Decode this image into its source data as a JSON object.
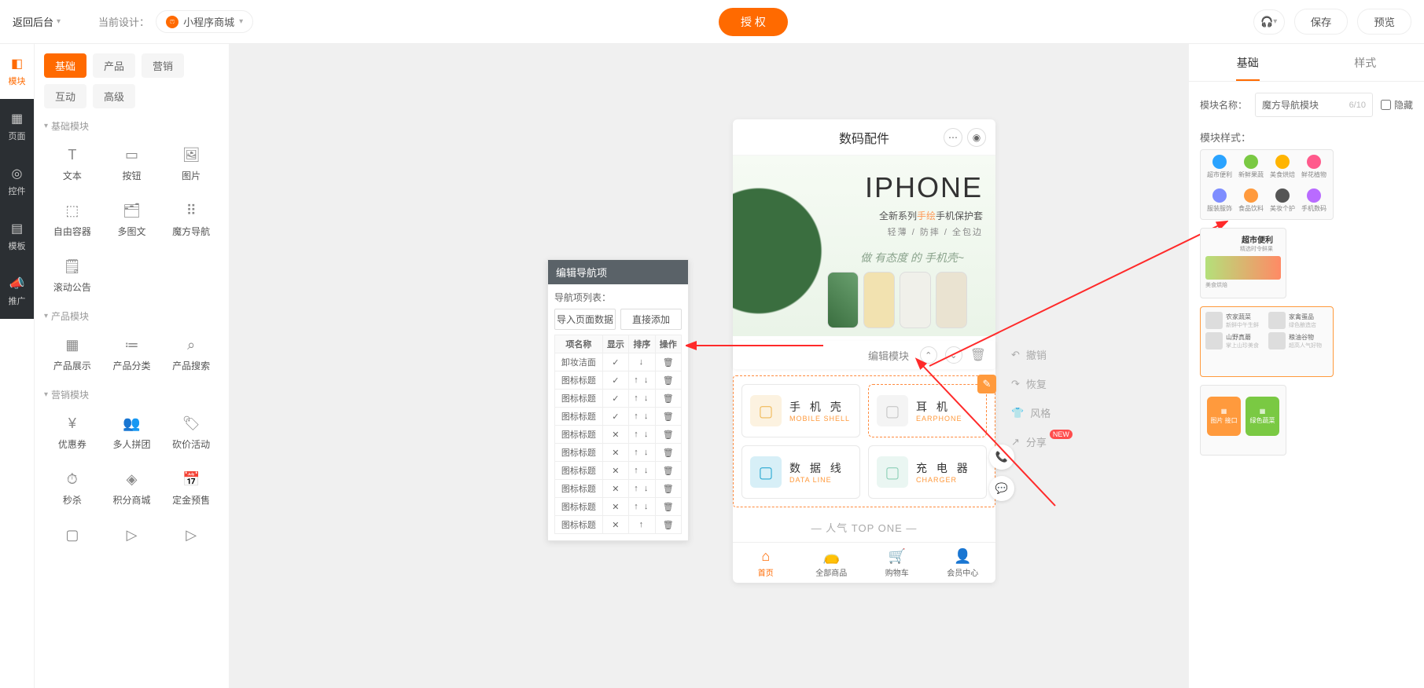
{
  "header": {
    "back": "返回后台",
    "current_design_label": "当前设计：",
    "current_design_value": "小程序商城",
    "auth_button": "授 权",
    "save": "保存",
    "preview": "预览"
  },
  "rail": [
    {
      "key": "module",
      "label": "模块",
      "active": true,
      "glyph": "◧"
    },
    {
      "key": "page",
      "label": "页面",
      "dark": true,
      "glyph": "▦"
    },
    {
      "key": "control",
      "label": "控件",
      "dark": true,
      "glyph": "◎"
    },
    {
      "key": "template",
      "label": "模板",
      "dark": true,
      "glyph": "▤"
    },
    {
      "key": "promote",
      "label": "推广",
      "dark": true,
      "glyph": "📣"
    }
  ],
  "sidebar": {
    "top_tabs": [
      {
        "label": "基础",
        "active": true
      },
      {
        "label": "产品"
      },
      {
        "label": "营销"
      },
      {
        "label": "互动"
      },
      {
        "label": "高级"
      }
    ],
    "sections": [
      {
        "title": "基础模块",
        "items": [
          {
            "label": "文本",
            "glyph": "T"
          },
          {
            "label": "按钮",
            "glyph": "▭"
          },
          {
            "label": "图片",
            "glyph": "🖼"
          },
          {
            "label": "自由容器",
            "glyph": "⬚"
          },
          {
            "label": "多图文",
            "glyph": "🗂"
          },
          {
            "label": "魔方导航",
            "glyph": "⠿"
          },
          {
            "label": "滚动公告",
            "glyph": "🗒"
          }
        ]
      },
      {
        "title": "产品模块",
        "items": [
          {
            "label": "产品展示",
            "glyph": "▦"
          },
          {
            "label": "产品分类",
            "glyph": "≔"
          },
          {
            "label": "产品搜索",
            "glyph": "⌕"
          }
        ]
      },
      {
        "title": "营销模块",
        "items": [
          {
            "label": "优惠券",
            "glyph": "¥"
          },
          {
            "label": "多人拼团",
            "glyph": "👥"
          },
          {
            "label": "砍价活动",
            "glyph": "🏷"
          },
          {
            "label": "秒杀",
            "glyph": "⏱"
          },
          {
            "label": "积分商城",
            "glyph": "◈"
          },
          {
            "label": "定金预售",
            "glyph": "📅"
          },
          {
            "label": "",
            "glyph": "▢"
          },
          {
            "label": "",
            "glyph": "▷"
          },
          {
            "label": "",
            "glyph": "▷"
          }
        ]
      }
    ]
  },
  "popover": {
    "title": "编辑导航项",
    "list_label": "导航项列表：",
    "import_btn": "导入页面数据",
    "add_btn": "直接添加",
    "th_name": "项名称",
    "th_show": "显示",
    "th_sort": "排序",
    "th_action": "操作",
    "rows": [
      {
        "name": "卸妆洁面",
        "show": true,
        "sort": "↓"
      },
      {
        "name": "图标标题",
        "show": true,
        "sort": "↑ ↓"
      },
      {
        "name": "图标标题",
        "show": true,
        "sort": "↑ ↓"
      },
      {
        "name": "图标标题",
        "show": true,
        "sort": "↑ ↓"
      },
      {
        "name": "图标标题",
        "show": false,
        "sort": "↑ ↓"
      },
      {
        "name": "图标标题",
        "show": false,
        "sort": "↑ ↓"
      },
      {
        "name": "图标标题",
        "show": false,
        "sort": "↑ ↓"
      },
      {
        "name": "图标标题",
        "show": false,
        "sort": "↑ ↓"
      },
      {
        "name": "图标标题",
        "show": false,
        "sort": "↑ ↓"
      },
      {
        "name": "图标标题",
        "show": false,
        "sort": "↑"
      }
    ]
  },
  "phone": {
    "title": "数码配件",
    "banner_h1": "IPHONE",
    "banner_sub_pre": "全新系列",
    "banner_sub_accent": "手绘",
    "banner_sub_post": "手机保护套",
    "banner_sub2": "轻薄 / 防摔 / 全包边",
    "banner_cursive": "做 有态度 的 手机壳~",
    "edit_label": "编辑模块",
    "nav_cards": [
      {
        "zh": "手 机 壳",
        "en": "MOBILE SHELL",
        "color": "#f0ba5a"
      },
      {
        "zh": "耳  机",
        "en": "EARPHONE",
        "color": "#c7c7c7",
        "selected": true
      },
      {
        "zh": "数 据 线",
        "en": "DATA LINE",
        "color": "#2aa9d2"
      },
      {
        "zh": "充 电 器",
        "en": "CHARGER",
        "color": "#8ed0b8"
      }
    ],
    "top_one": "—  人气 TOP ONE  —",
    "tabbar": [
      {
        "label": "首页",
        "glyph": "⌂",
        "active": true
      },
      {
        "label": "全部商品",
        "glyph": "👝"
      },
      {
        "label": "购物车",
        "glyph": "🛒"
      },
      {
        "label": "会员中心",
        "glyph": "👤"
      }
    ]
  },
  "actions": {
    "undo": "撤销",
    "redo": "恢复",
    "style": "风格",
    "share": "分享",
    "new_badge": "NEW"
  },
  "right_panel": {
    "tab_basic": "基础",
    "tab_style": "样式",
    "module_name_label": "模块名称：",
    "module_name_value": "魔方导航模块",
    "module_name_counter": "6/10",
    "hide_checkbox": "隐藏",
    "style_label": "模块样式：",
    "style1_dots": [
      {
        "color": "#2aa3ff",
        "label": "超市便利"
      },
      {
        "color": "#7ac943",
        "label": "新鲜果蔬"
      },
      {
        "color": "#ffb400",
        "label": "美食烘焙"
      },
      {
        "color": "#ff5a8c",
        "label": "鲜花植物"
      },
      {
        "color": "#7e8dff",
        "label": "服装服饰"
      },
      {
        "color": "#ff9a3d",
        "label": "食品饮料"
      },
      {
        "color": "#555",
        "label": "美妆个护"
      },
      {
        "color": "#b96bff",
        "label": "手机数码"
      }
    ],
    "style2_title": "超市便利",
    "style2_sub": "精选时令鲜果",
    "style2_tag": "美食烘焙",
    "style3_items": [
      {
        "t1": "农家蔬菜",
        "t2": "新鲜中午生鲜"
      },
      {
        "t1": "家禽蛋品",
        "t2": "绿色酿造店"
      },
      {
        "t1": "山野真蘑",
        "t2": "掌上山珍美食"
      },
      {
        "t1": "粮油谷物",
        "t2": "超高人气好物"
      }
    ],
    "style4_blocks": [
      {
        "label": "图片 接口",
        "color": "#ff9a3d"
      },
      {
        "label": "绿色蔬菜",
        "color": "#7ac943"
      }
    ]
  }
}
